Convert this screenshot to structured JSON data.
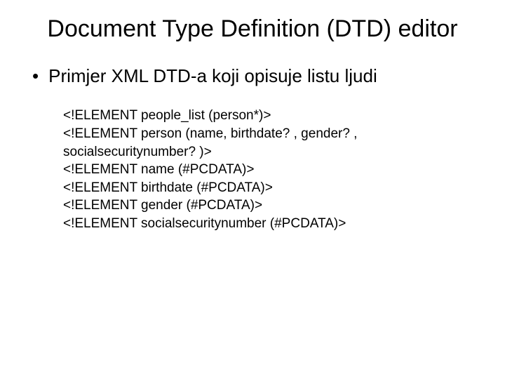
{
  "title": "Document Type Definition (DTD) editor",
  "bullet": {
    "marker": "•",
    "text": "Primjer XML DTD-a koji opisuje listu ljudi"
  },
  "code": {
    "lines": [
      "<!ELEMENT people_list (person*)>",
      "<!ELEMENT person (name, birthdate? , gender? , socialsecuritynumber? )>",
      "<!ELEMENT name (#PCDATA)>",
      "<!ELEMENT birthdate (#PCDATA)>",
      "<!ELEMENT gender (#PCDATA)>",
      "<!ELEMENT socialsecuritynumber (#PCDATA)>"
    ]
  }
}
